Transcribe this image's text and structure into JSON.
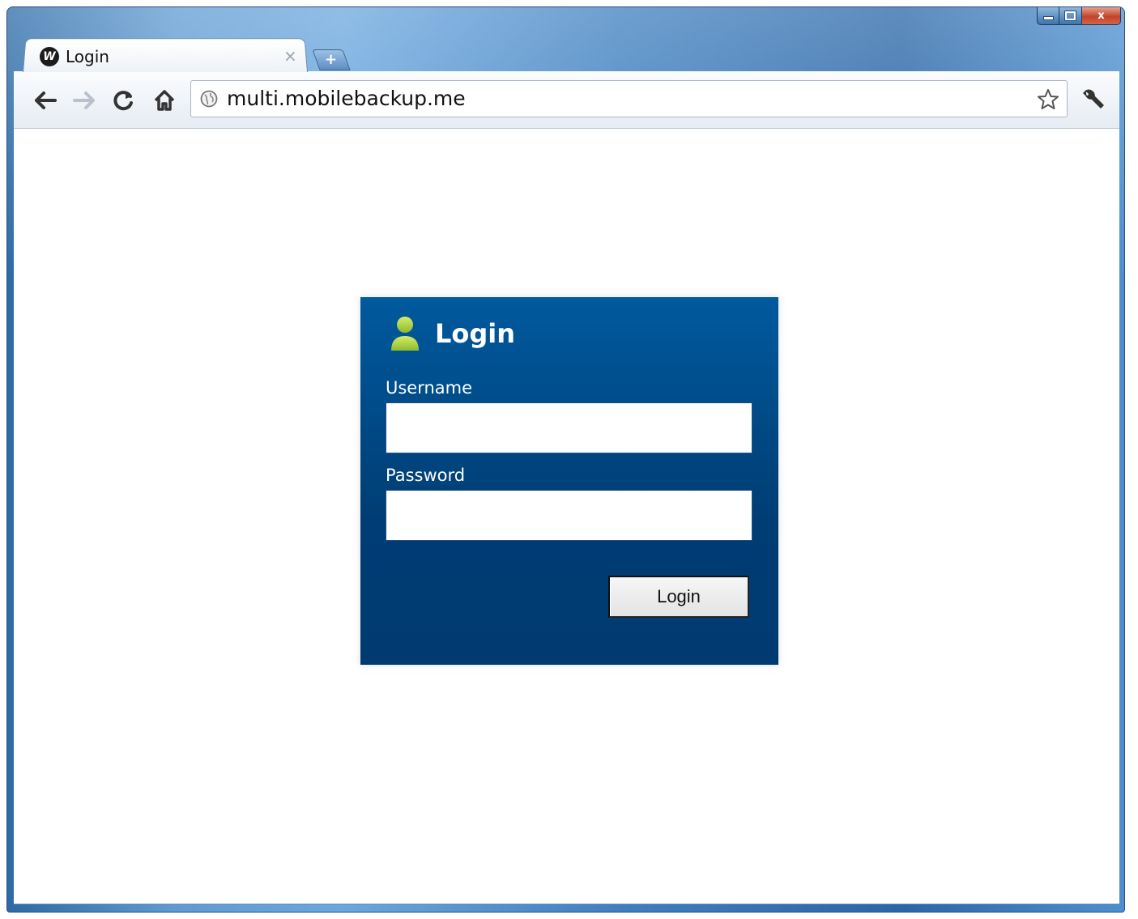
{
  "browser": {
    "tab": {
      "title": "Login",
      "favicon_text": "W",
      "close_glyph": "×"
    },
    "new_tab_glyph": "+",
    "address_bar": {
      "url": "multi.mobilebackup.me"
    },
    "icons": {
      "back": "back-arrow-icon",
      "forward": "forward-arrow-icon",
      "reload": "reload-icon",
      "home": "home-icon",
      "page_info": "globe-icon",
      "bookmark": "star-icon",
      "settings": "wrench-icon"
    },
    "window_controls": {
      "minimize": "minimize-icon",
      "maximize": "maximize-icon",
      "close": "x"
    }
  },
  "login_form": {
    "heading": "Login",
    "username_label": "Username",
    "username_value": "",
    "password_label": "Password",
    "password_value": "",
    "submit_label": "Login",
    "colors": {
      "panel_top": "#005a9e",
      "panel_bottom": "#003a70",
      "user_icon": "#b7d84a"
    }
  }
}
